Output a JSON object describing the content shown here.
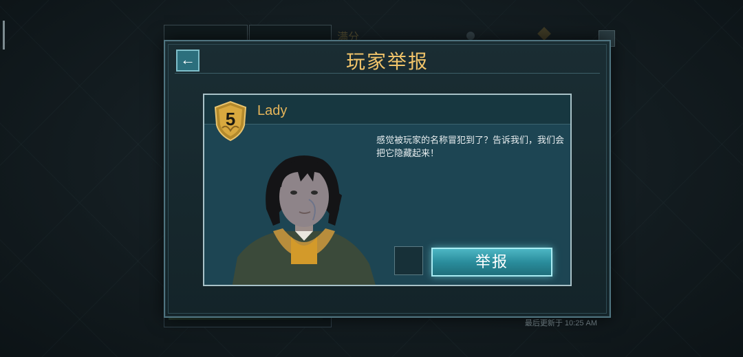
{
  "background": {
    "tab_label": "满分",
    "updated_text": "最后更新于 10:25 AM"
  },
  "modal": {
    "title": "玩家举报",
    "back_icon": "arrow-left-icon"
  },
  "player": {
    "level": "5",
    "name": "Lady"
  },
  "report": {
    "prompt": "感觉被玩家的名称冒犯到了？告诉我们，我们会把它隐藏起来！",
    "button_label": "举报"
  },
  "colors": {
    "title_gold": "#f1c46a",
    "name_gold": "#e6b55a",
    "button_teal": "#2a8d9c",
    "card_bg": "#1d4553"
  }
}
